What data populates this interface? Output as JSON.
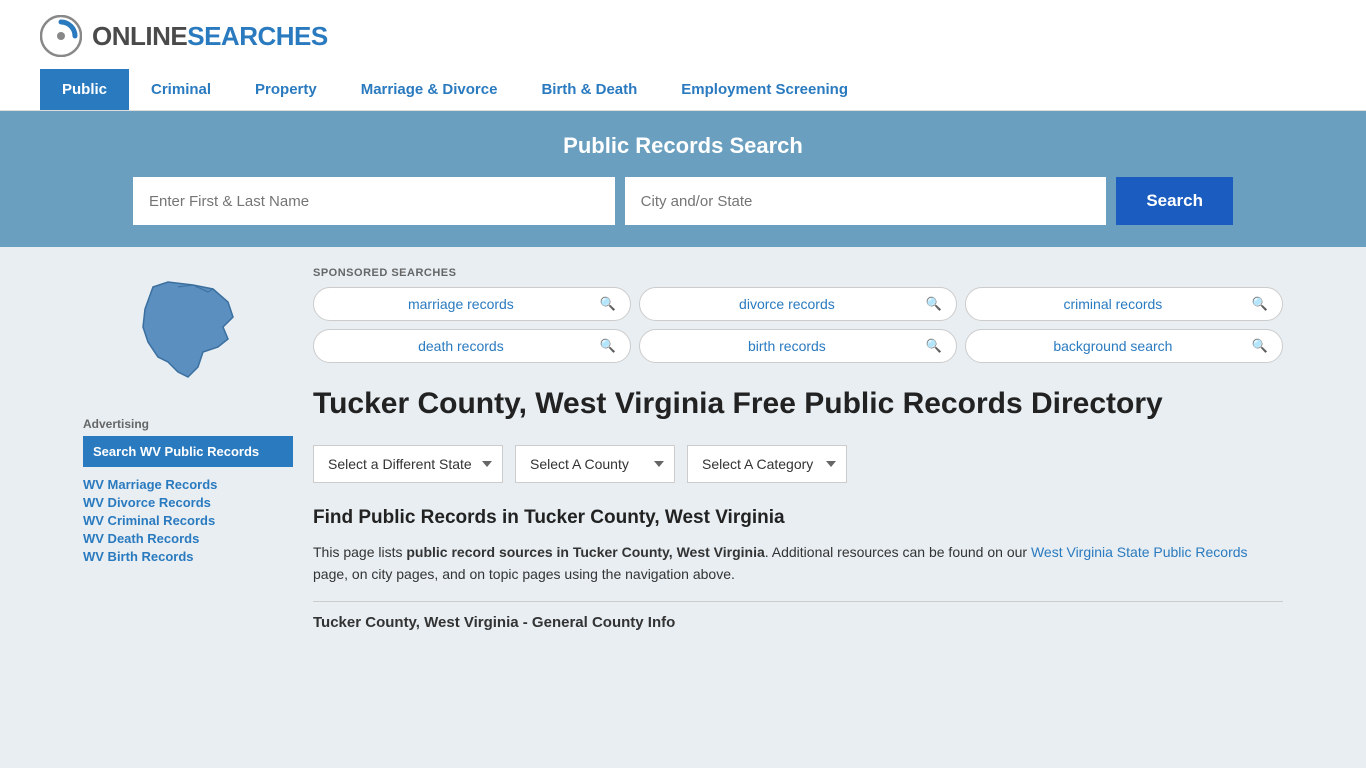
{
  "logo": {
    "text_online": "ONLINE",
    "text_searches": "SEARCHES"
  },
  "nav": {
    "items": [
      {
        "label": "Public",
        "active": true
      },
      {
        "label": "Criminal",
        "active": false
      },
      {
        "label": "Property",
        "active": false
      },
      {
        "label": "Marriage & Divorce",
        "active": false
      },
      {
        "label": "Birth & Death",
        "active": false
      },
      {
        "label": "Employment Screening",
        "active": false
      }
    ]
  },
  "search_banner": {
    "title": "Public Records Search",
    "name_placeholder": "Enter First & Last Name",
    "location_placeholder": "City and/or State",
    "button_label": "Search"
  },
  "sponsored": {
    "label": "SPONSORED SEARCHES",
    "items": [
      {
        "text": "marriage records"
      },
      {
        "text": "divorce records"
      },
      {
        "text": "criminal records"
      },
      {
        "text": "death records"
      },
      {
        "text": "birth records"
      },
      {
        "text": "background search"
      }
    ]
  },
  "page": {
    "heading": "Tucker County, West Virginia Free Public Records Directory",
    "dropdowns": {
      "state": "Select a Different State",
      "county": "Select A County",
      "category": "Select A Category"
    },
    "find_heading": "Find Public Records in Tucker County, West Virginia",
    "find_text_1": "This page lists ",
    "find_text_bold": "public record sources in Tucker County, West Virginia",
    "find_text_2": ". Additional resources can be found on our ",
    "find_link_text": "West Virginia State Public Records",
    "find_text_3": " page, on city pages, and on topic pages using the navigation above.",
    "general_info": "Tucker County, West Virginia - General County Info"
  },
  "sidebar": {
    "ad_label": "Advertising",
    "ad_link_text": "Search WV Public Records",
    "links": [
      "WV Marriage Records",
      "WV Divorce Records",
      "WV Criminal Records",
      "WV Death Records",
      "WV Birth Records"
    ]
  }
}
